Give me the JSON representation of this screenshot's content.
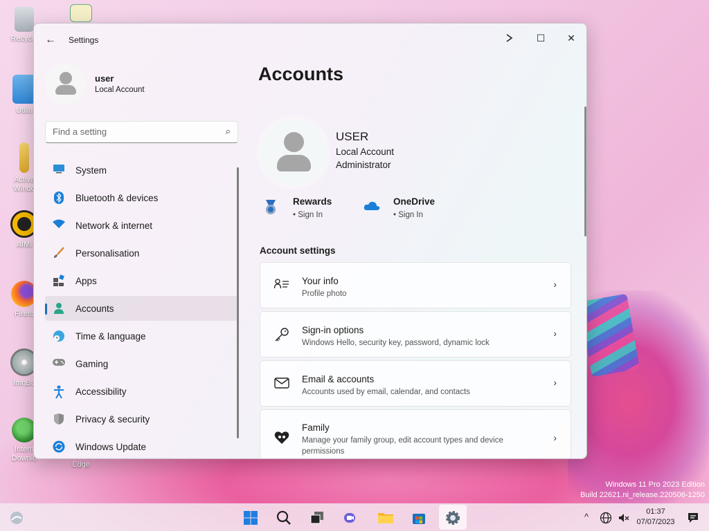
{
  "desktop": {
    "icons": [
      {
        "label": "Recycle"
      },
      {
        "label": "Utiliti"
      },
      {
        "label": "Activa Windo"
      },
      {
        "label": "AIMI"
      },
      {
        "label": "Firefo"
      },
      {
        "label": "ImgBu"
      },
      {
        "label": "Intern Downlo"
      },
      {
        "label": "Edge"
      }
    ],
    "watermark": {
      "line1": "Windows 11 Pro 2023 Edition",
      "line2": "Build 22621.ni_release.220506-1250"
    }
  },
  "window": {
    "title": "Settings",
    "back_glyph": "←",
    "controls": {
      "minimize": "",
      "maximize": "☐",
      "close": "✕"
    }
  },
  "sidebar": {
    "user": {
      "name": "user",
      "type": "Local Account"
    },
    "search": {
      "placeholder": "Find a setting",
      "value": "",
      "icon": "⌕"
    },
    "items": [
      {
        "label": "System",
        "icon": "system-icon"
      },
      {
        "label": "Bluetooth & devices",
        "icon": "bluetooth-icon"
      },
      {
        "label": "Network & internet",
        "icon": "wifi-icon"
      },
      {
        "label": "Personalisation",
        "icon": "brush-icon"
      },
      {
        "label": "Apps",
        "icon": "apps-icon"
      },
      {
        "label": "Accounts",
        "icon": "accounts-icon",
        "active": true
      },
      {
        "label": "Time & language",
        "icon": "globe-icon"
      },
      {
        "label": "Gaming",
        "icon": "gamepad-icon"
      },
      {
        "label": "Accessibility",
        "icon": "accessibility-icon"
      },
      {
        "label": "Privacy & security",
        "icon": "shield-icon"
      },
      {
        "label": "Windows Update",
        "icon": "update-icon"
      }
    ]
  },
  "main": {
    "title": "Accounts",
    "profile": {
      "name": "USER",
      "account_type": "Local Account",
      "role": "Administrator"
    },
    "services": [
      {
        "name": "Rewards",
        "link": "• Sign In"
      },
      {
        "name": "OneDrive",
        "link": "• Sign In"
      }
    ],
    "section_title": "Account settings",
    "cards": [
      {
        "title": "Your info",
        "subtitle": "Profile photo"
      },
      {
        "title": "Sign-in options",
        "subtitle": "Windows Hello, security key, password, dynamic lock"
      },
      {
        "title": "Email & accounts",
        "subtitle": "Accounts used by email, calendar, and contacts"
      },
      {
        "title": "Family",
        "subtitle": "Manage your family group, edit account types and device permissions"
      }
    ],
    "chevron": "›"
  },
  "taskbar": {
    "tray_up": "^",
    "clock": {
      "time": "01:37",
      "date": "07/07/2023"
    }
  },
  "colors": {
    "accent": "#1b6fb8",
    "window_bg": "#f6f0f8",
    "taskbar_bg": "#f3e8f1"
  }
}
